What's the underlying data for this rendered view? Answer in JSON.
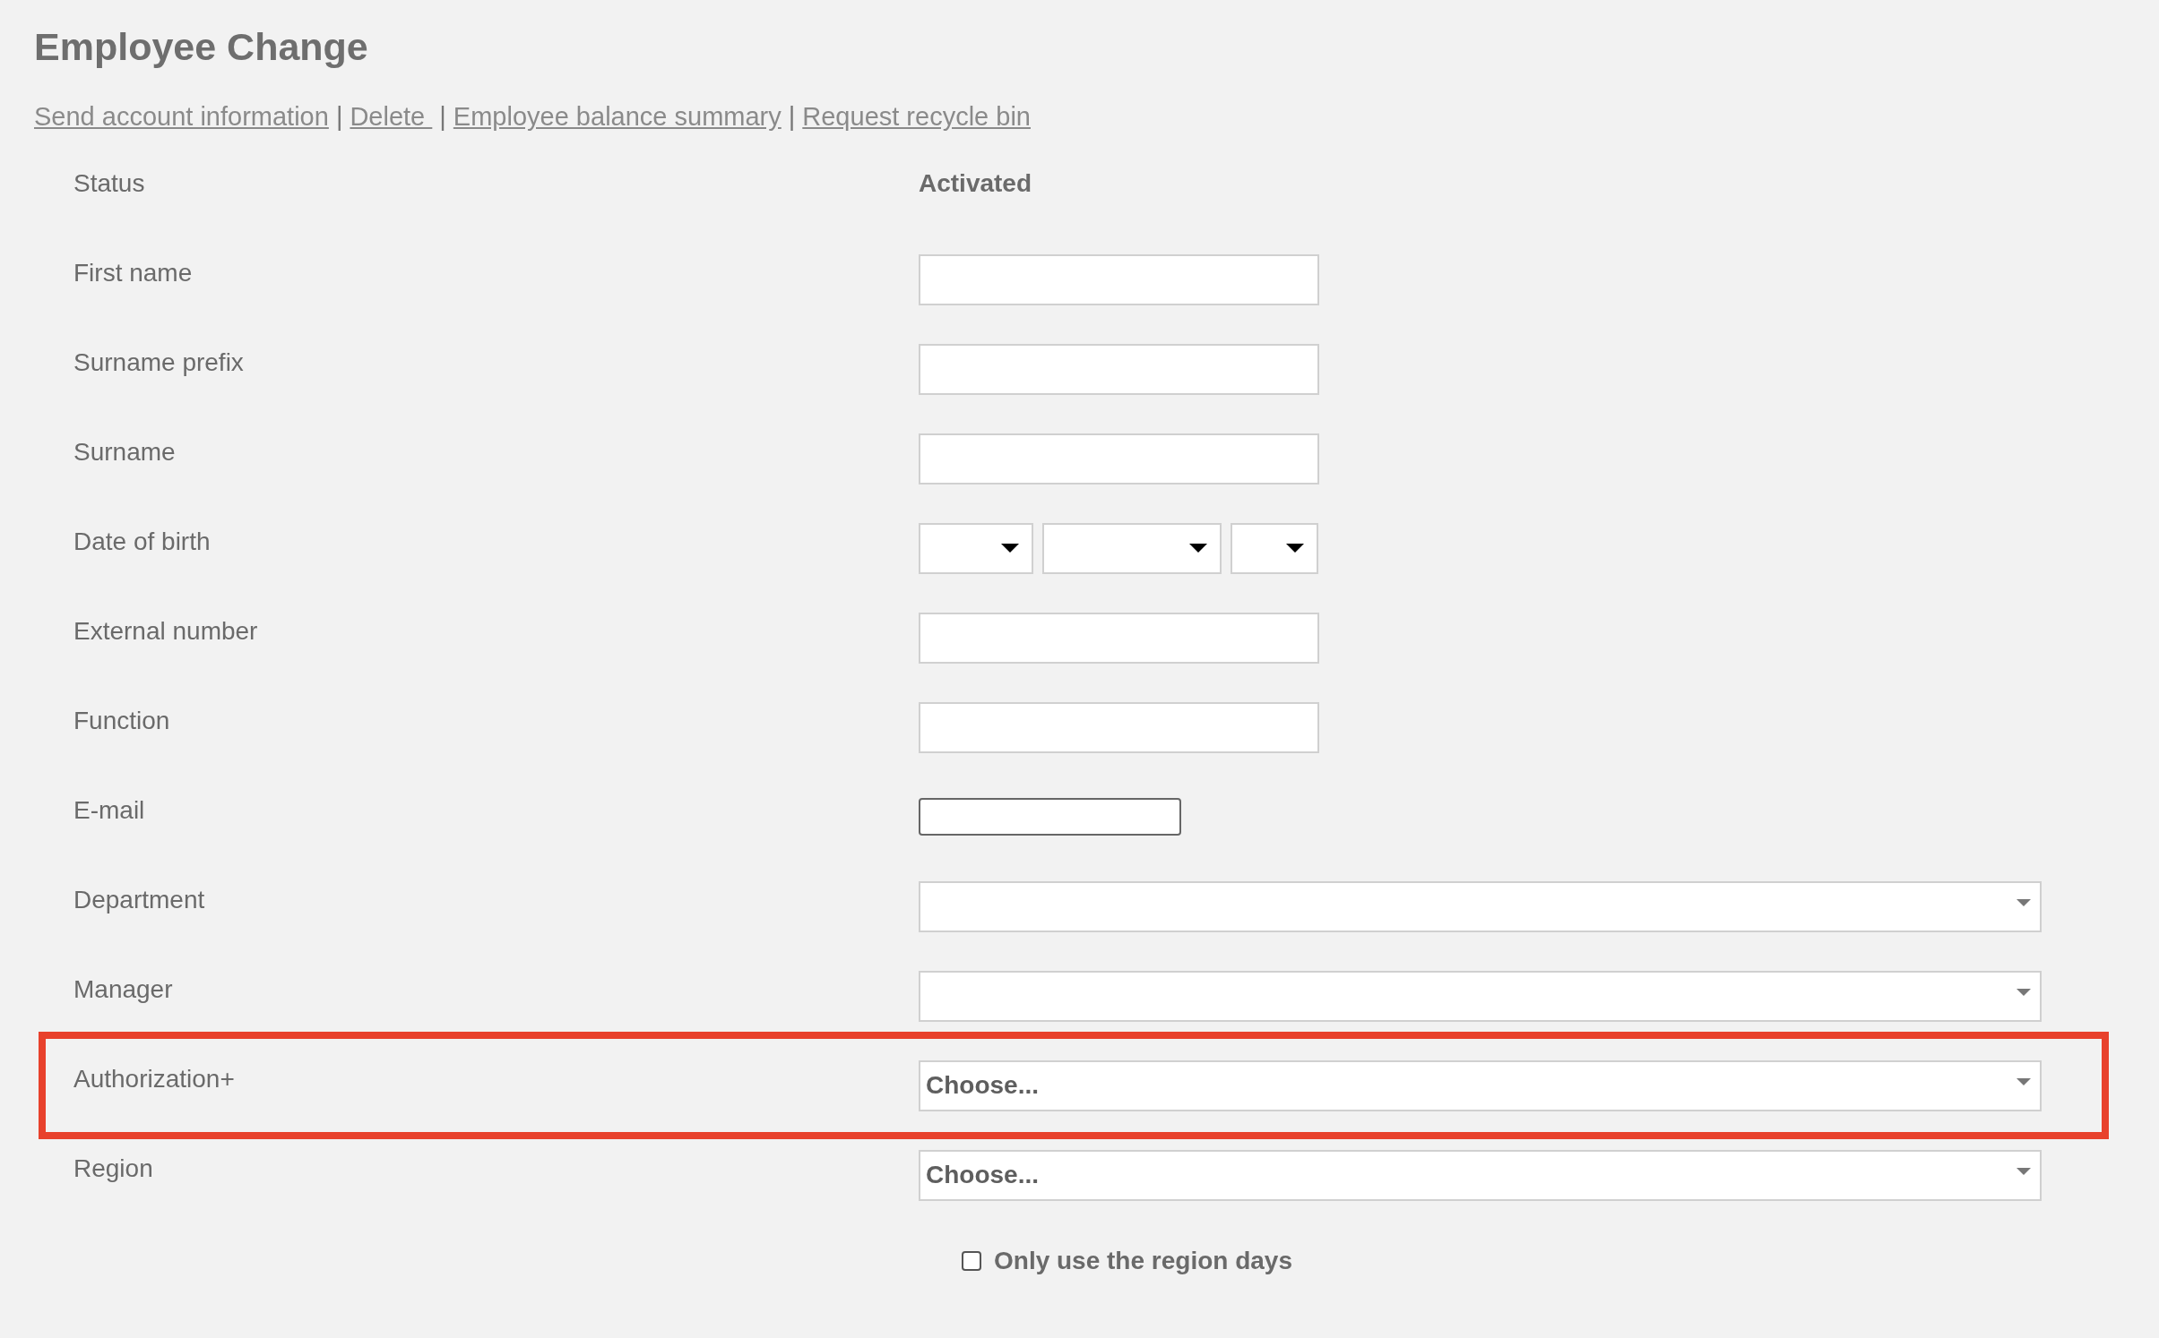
{
  "title": "Employee Change",
  "links": [
    "Send account information",
    "Delete ",
    "Employee balance summary",
    "Request recycle bin"
  ],
  "link_separator": "|",
  "rows": [
    {
      "label": "Status",
      "kind": "text",
      "value": "Activated",
      "highlighted": false
    },
    {
      "label": "First name",
      "kind": "input",
      "highlighted": false
    },
    {
      "label": "Surname prefix",
      "kind": "input",
      "highlighted": false
    },
    {
      "label": "Surname",
      "kind": "input",
      "highlighted": false
    },
    {
      "label": "Date of birth",
      "kind": "date",
      "highlighted": false
    },
    {
      "label": "External number",
      "kind": "input",
      "highlighted": false
    },
    {
      "label": "Function",
      "kind": "input",
      "highlighted": false
    },
    {
      "label": "E-mail",
      "kind": "email",
      "highlighted": false
    },
    {
      "label": "Department",
      "kind": "select",
      "highlighted": false
    },
    {
      "label": "Manager",
      "kind": "select",
      "highlighted": false
    },
    {
      "label": "Authorization+",
      "kind": "select",
      "value": "Choose...",
      "highlighted": true
    },
    {
      "label": "Region",
      "kind": "select",
      "value": "Choose...",
      "highlighted": false
    }
  ],
  "checkbox": {
    "label": "Only use the region days",
    "checked": false
  }
}
